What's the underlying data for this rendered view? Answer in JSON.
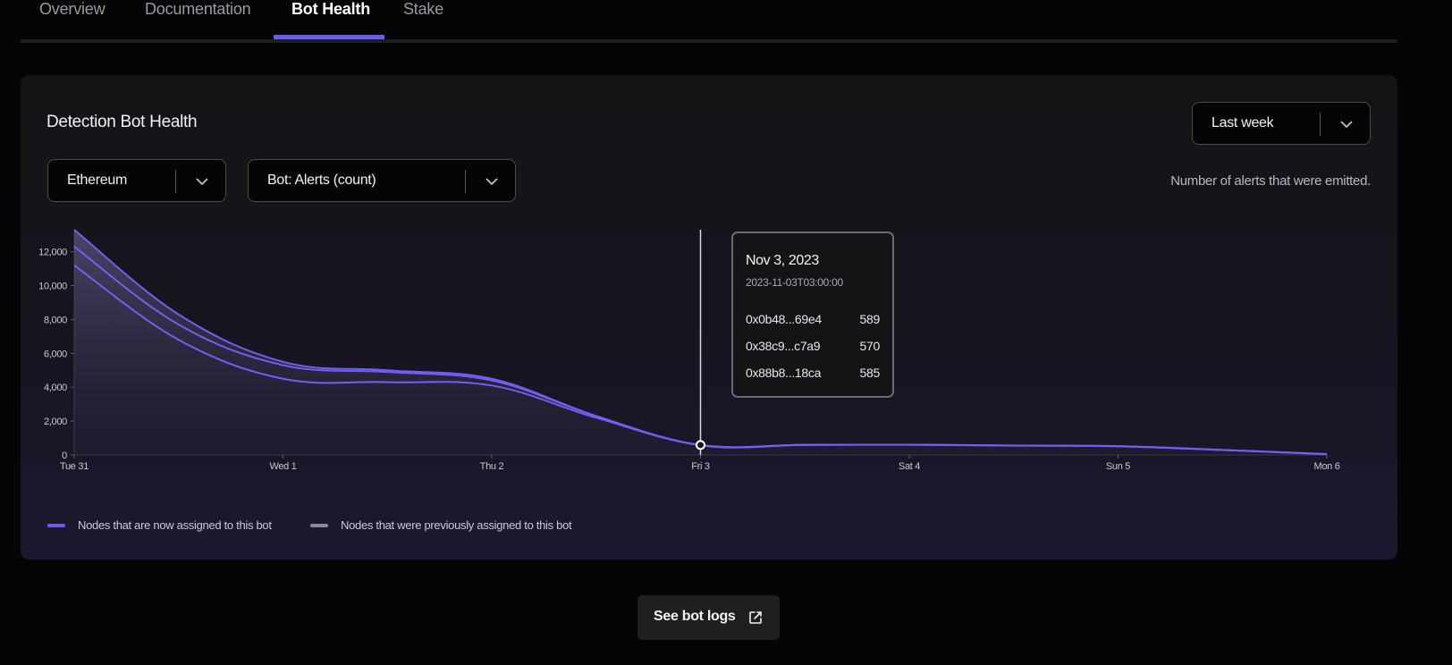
{
  "tabs": [
    {
      "label": "Overview",
      "active": false
    },
    {
      "label": "Documentation",
      "active": false
    },
    {
      "label": "Bot Health",
      "active": true
    },
    {
      "label": "Stake",
      "active": false
    }
  ],
  "panel": {
    "title": "Detection Bot Health",
    "range_select": {
      "value": "Last week"
    },
    "network_select": {
      "value": "Ethereum"
    },
    "metric_select": {
      "value": "Bot: Alerts (count)"
    },
    "description": "Number of alerts that were emitted."
  },
  "tooltip": {
    "date": "Nov 3, 2023",
    "timestamp": "2023-11-03T03:00:00",
    "rows": [
      {
        "node": "0x0b48...69e4",
        "value": "589"
      },
      {
        "node": "0x38c9...c7a9",
        "value": "570"
      },
      {
        "node": "0x88b8...18ca",
        "value": "585"
      }
    ]
  },
  "legend": [
    {
      "label": "Nodes that are now assigned to this bot",
      "color": "#6b5cf0"
    },
    {
      "label": "Nodes that were previously assigned to this bot",
      "color": "#8a8a92"
    }
  ],
  "colors": {
    "accent": "#6b5cf0",
    "line": "#6f5ff2"
  },
  "chart_data": {
    "type": "line",
    "ylim": [
      0,
      13300
    ],
    "yticks": [
      "0",
      "2,000",
      "4,000",
      "6,000",
      "8,000",
      "10,000",
      "12,000"
    ],
    "ytick_values": [
      0,
      2000,
      4000,
      6000,
      8000,
      10000,
      12000
    ],
    "xtick_labels": [
      "Tue 31",
      "Wed 1",
      "Thu 2",
      "Fri 3",
      "Sat 4",
      "Sun 5",
      "Mon 6"
    ],
    "x": [
      0,
      0.5,
      1,
      1.5,
      2,
      2.5,
      3,
      3.5,
      4,
      4.5,
      5,
      5.5,
      6
    ],
    "series": [
      {
        "name": "0x0b48...69e4",
        "values": [
          13300,
          8300,
          5500,
          5000,
          4500,
          2300,
          589,
          600,
          610,
          560,
          520,
          300,
          50
        ]
      },
      {
        "name": "0x38c9...c7a9",
        "values": [
          12300,
          7700,
          5300,
          4900,
          4400,
          2300,
          570,
          590,
          600,
          550,
          510,
          290,
          40
        ]
      },
      {
        "name": "0x88b8...18ca",
        "values": [
          11200,
          6800,
          4500,
          4300,
          4100,
          2200,
          585,
          595,
          605,
          555,
          515,
          295,
          45
        ]
      }
    ],
    "highlight": {
      "x": 3,
      "label": "Fri 3"
    },
    "grid": false
  },
  "logs_button": {
    "label": "See bot logs"
  }
}
